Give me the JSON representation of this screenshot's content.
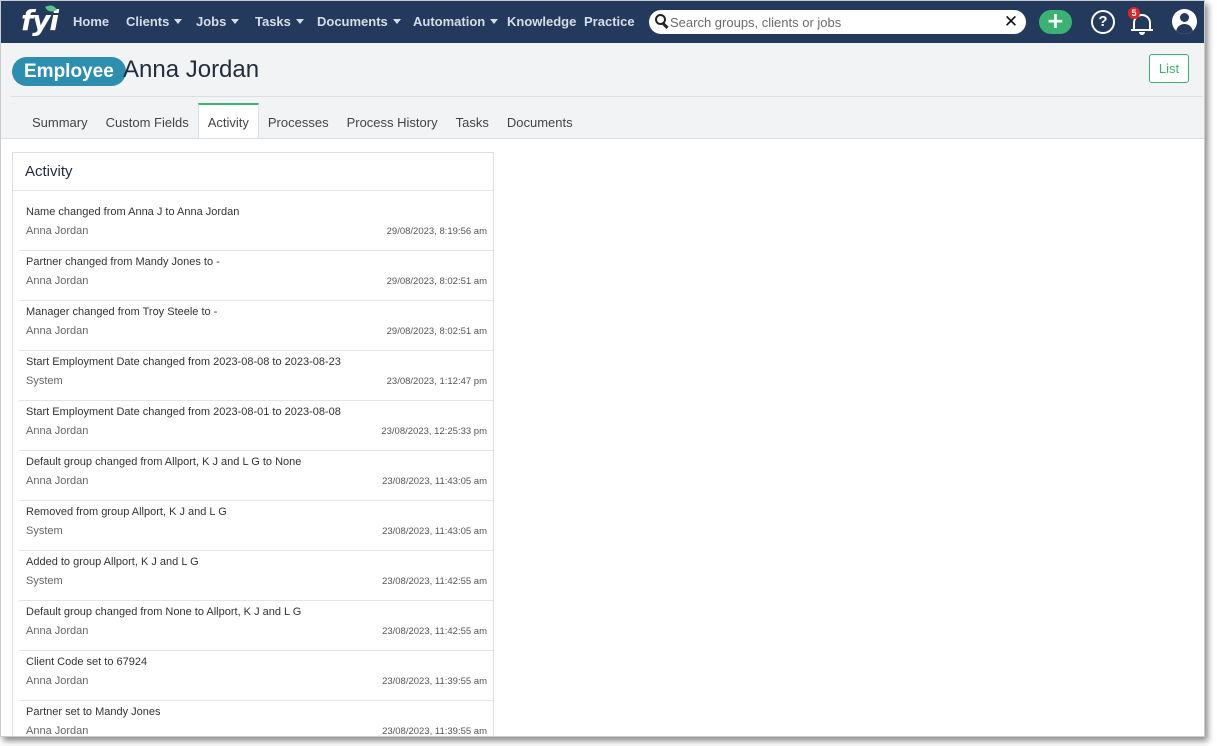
{
  "nav": {
    "logo_text": "fyi",
    "items": [
      "Home",
      "Clients",
      "Jobs",
      "Tasks",
      "Documents",
      "Automation",
      "Knowledge",
      "Practice"
    ],
    "search_placeholder": "Search groups, clients or jobs",
    "add_label": "+",
    "help_label": "?",
    "notification_count": "5"
  },
  "header": {
    "type_label": "Employee",
    "title": "Anna Jordan",
    "list_button": "List"
  },
  "tabs": [
    "Summary",
    "Custom Fields",
    "Activity",
    "Processes",
    "Process History",
    "Tasks",
    "Documents"
  ],
  "activity": {
    "title": "Activity",
    "items": [
      {
        "text": "Name changed from Anna J to Anna Jordan",
        "user": "Anna Jordan",
        "time": "29/08/2023, 8:19:56 am"
      },
      {
        "text": "Partner changed from Mandy Jones to -",
        "user": "Anna Jordan",
        "time": "29/08/2023, 8:02:51 am"
      },
      {
        "text": "Manager changed from Troy Steele to -",
        "user": "Anna Jordan",
        "time": "29/08/2023, 8:02:51 am"
      },
      {
        "text": "Start Employment Date changed from 2023-08-08 to 2023-08-23",
        "user": "System",
        "time": "23/08/2023, 1:12:47 pm"
      },
      {
        "text": "Start Employment Date changed from 2023-08-01 to 2023-08-08",
        "user": "Anna Jordan",
        "time": "23/08/2023, 12:25:33 pm"
      },
      {
        "text": "Default group changed from Allport, K J and L G to None",
        "user": "Anna Jordan",
        "time": "23/08/2023, 11:43:05 am"
      },
      {
        "text": "Removed from group Allport, K J and L G",
        "user": "System",
        "time": "23/08/2023, 11:43:05 am"
      },
      {
        "text": "Added to group Allport, K J and L G",
        "user": "System",
        "time": "23/08/2023, 11:42:55 am"
      },
      {
        "text": "Default group changed from None to Allport, K J and L G",
        "user": "Anna Jordan",
        "time": "23/08/2023, 11:42:55 am"
      },
      {
        "text": "Client Code set to 67924",
        "user": "Anna Jordan",
        "time": "23/08/2023, 11:39:55 am"
      },
      {
        "text": "Partner set to Mandy Jones",
        "user": "Anna Jordan",
        "time": "23/08/2023, 11:39:55 am"
      }
    ]
  },
  "colors": {
    "nav_bg": "#233a5c",
    "accent_green": "#3bb273",
    "employee_pill": "#2c8fb0",
    "badge_red": "#e02424"
  }
}
